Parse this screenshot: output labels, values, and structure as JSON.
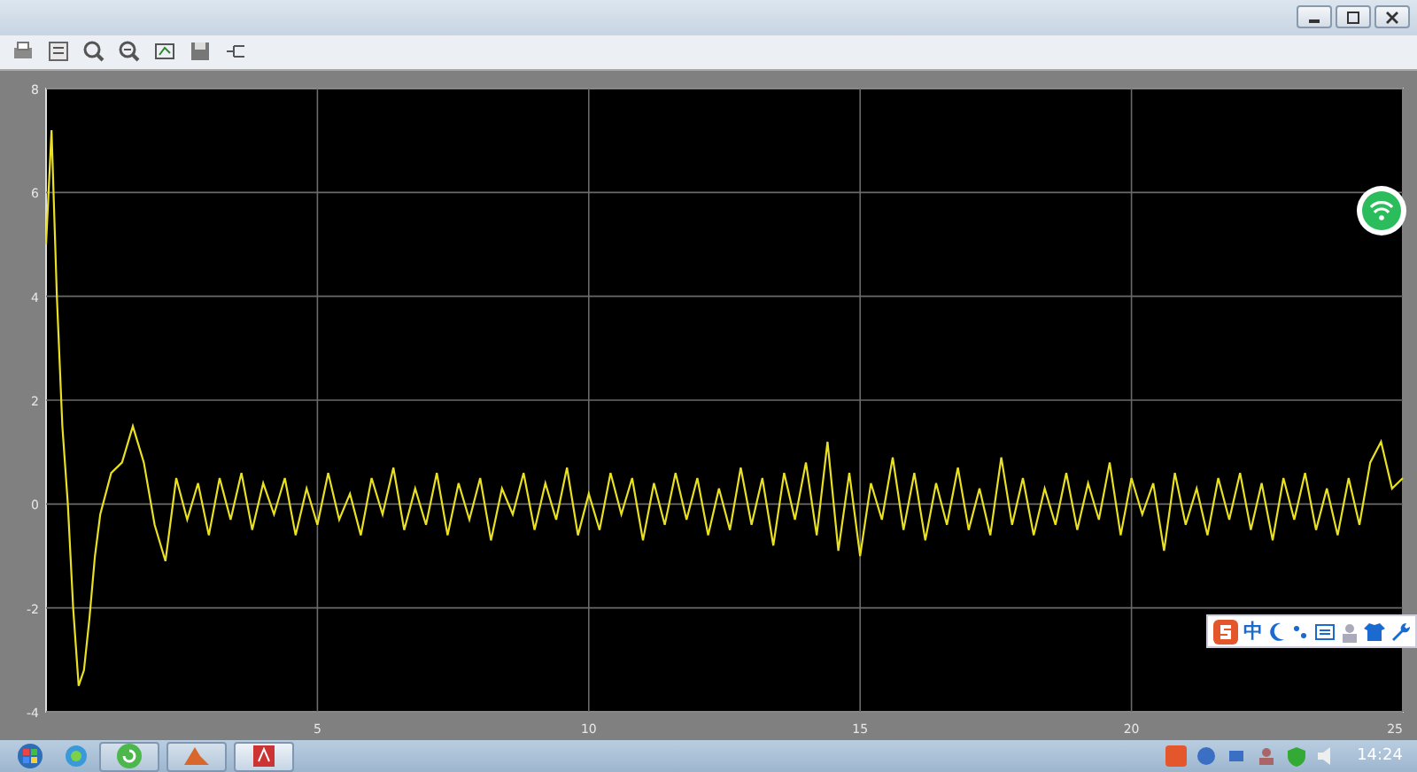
{
  "scope": {
    "chart_data": {
      "type": "line",
      "xlim": [
        0,
        25
      ],
      "ylim": [
        -4,
        8
      ],
      "xticks": [
        5,
        10,
        15,
        20,
        25
      ],
      "yticks": [
        -4,
        -2,
        0,
        2,
        4,
        6,
        8
      ],
      "x": [
        0,
        0.1,
        0.2,
        0.3,
        0.4,
        0.5,
        0.6,
        0.7,
        0.8,
        0.9,
        1.0,
        1.2,
        1.4,
        1.6,
        1.8,
        2.0,
        2.2,
        2.4,
        2.6,
        2.8,
        3.0,
        3.2,
        3.4,
        3.6,
        3.8,
        4.0,
        4.2,
        4.4,
        4.6,
        4.8,
        5.0,
        5.2,
        5.4,
        5.6,
        5.8,
        6.0,
        6.2,
        6.4,
        6.6,
        6.8,
        7.0,
        7.2,
        7.4,
        7.6,
        7.8,
        8.0,
        8.2,
        8.4,
        8.6,
        8.8,
        9.0,
        9.2,
        9.4,
        9.6,
        9.8,
        10.0,
        10.2,
        10.4,
        10.6,
        10.8,
        11.0,
        11.2,
        11.4,
        11.6,
        11.8,
        12.0,
        12.2,
        12.4,
        12.6,
        12.8,
        13.0,
        13.2,
        13.4,
        13.6,
        13.8,
        14.0,
        14.2,
        14.4,
        14.6,
        14.8,
        15.0,
        15.2,
        15.4,
        15.6,
        15.8,
        16.0,
        16.2,
        16.4,
        16.6,
        16.8,
        17.0,
        17.2,
        17.4,
        17.6,
        17.8,
        18.0,
        18.2,
        18.4,
        18.6,
        18.8,
        19.0,
        19.2,
        19.4,
        19.6,
        19.8,
        20.0,
        20.2,
        20.4,
        20.6,
        20.8,
        21.0,
        21.2,
        21.4,
        21.6,
        21.8,
        22.0,
        22.2,
        22.4,
        22.6,
        22.8,
        23.0,
        23.2,
        23.4,
        23.6,
        23.8,
        24.0,
        24.2,
        24.4,
        24.6,
        24.8,
        25.0
      ],
      "grid": true,
      "series": [
        {
          "color": "#e8e020",
          "values": [
            5.0,
            7.2,
            4.0,
            1.5,
            0.0,
            -2.0,
            -3.5,
            -3.2,
            -2.2,
            -1.0,
            -0.2,
            0.6,
            0.8,
            1.5,
            0.8,
            -0.4,
            -1.1,
            0.5,
            -0.3,
            0.4,
            -0.6,
            0.5,
            -0.3,
            0.6,
            -0.5,
            0.4,
            -0.2,
            0.5,
            -0.6,
            0.3,
            -0.4,
            0.6,
            -0.3,
            0.2,
            -0.6,
            0.5,
            -0.2,
            0.7,
            -0.5,
            0.3,
            -0.4,
            0.6,
            -0.6,
            0.4,
            -0.3,
            0.5,
            -0.7,
            0.3,
            -0.2,
            0.6,
            -0.5,
            0.4,
            -0.3,
            0.7,
            -0.6,
            0.2,
            -0.5,
            0.6,
            -0.2,
            0.5,
            -0.7,
            0.4,
            -0.4,
            0.6,
            -0.3,
            0.5,
            -0.6,
            0.3,
            -0.5,
            0.7,
            -0.4,
            0.5,
            -0.8,
            0.6,
            -0.3,
            0.8,
            -0.6,
            1.2,
            -0.9,
            0.6,
            -1.0,
            0.4,
            -0.3,
            0.9,
            -0.5,
            0.6,
            -0.7,
            0.4,
            -0.4,
            0.7,
            -0.5,
            0.3,
            -0.6,
            0.9,
            -0.4,
            0.5,
            -0.6,
            0.3,
            -0.4,
            0.6,
            -0.5,
            0.4,
            -0.3,
            0.8,
            -0.6,
            0.5,
            -0.2,
            0.4,
            -0.9,
            0.6,
            -0.4,
            0.3,
            -0.6,
            0.5,
            -0.3,
            0.6,
            -0.5,
            0.4,
            -0.7,
            0.5,
            -0.3,
            0.6,
            -0.5,
            0.3,
            -0.6,
            0.5,
            -0.4,
            0.8,
            1.2,
            0.3,
            0.5
          ]
        }
      ]
    }
  },
  "ime_bar": {
    "mode": "中"
  },
  "taskbar": {
    "clock": "14:24"
  }
}
